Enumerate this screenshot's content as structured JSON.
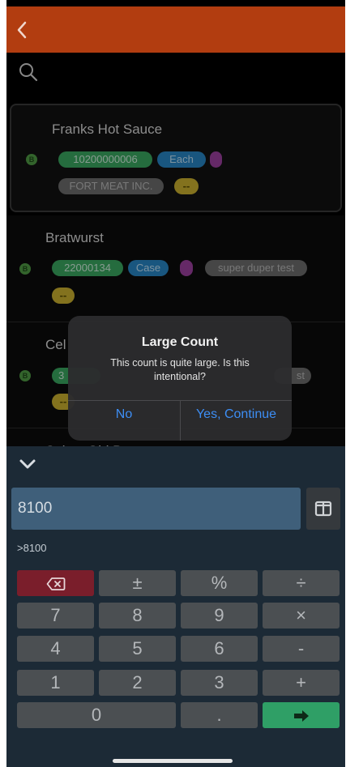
{
  "colors": {
    "header": "#b23d10",
    "accent_blue": "#3d8ef5",
    "enter_key": "#2f9f66",
    "delete_key": "#7a1e2b"
  },
  "icons": {
    "back": "chevron-left-icon",
    "search": "search-icon",
    "collapse": "chevron-down-icon",
    "layout": "columns-icon",
    "backspace": "backspace-icon",
    "enter": "enter-arrow-icon"
  },
  "list": {
    "items": [
      {
        "name": "Franks Hot Sauce",
        "indicator": "B",
        "code": "10200000006",
        "unit": "Each",
        "vendor": "FORT MEAT INC.",
        "tag": "--"
      },
      {
        "name": "Bratwurst",
        "indicator": "B",
        "code": "22000134",
        "unit": "Case",
        "note": "super duper test",
        "tag": "--"
      },
      {
        "name": "Cel",
        "indicator": "B",
        "code": "3",
        "note": "st",
        "tag": "--"
      },
      {
        "name": "Spice, Old Bay"
      }
    ]
  },
  "alert": {
    "title": "Large Count",
    "message": "This count is quite large. Is this intentional?",
    "cancel_label": "No",
    "confirm_label": "Yes, Continue"
  },
  "keypad": {
    "value": "8100",
    "expression": ">8100",
    "keys": {
      "plus_minus": "±",
      "percent": "%",
      "divide": "÷",
      "seven": "7",
      "eight": "8",
      "nine": "9",
      "multiply": "×",
      "four": "4",
      "five": "5",
      "six": "6",
      "minus": "-",
      "one": "1",
      "two": "2",
      "three": "3",
      "plus": "+",
      "zero": "0",
      "decimal": "."
    }
  }
}
